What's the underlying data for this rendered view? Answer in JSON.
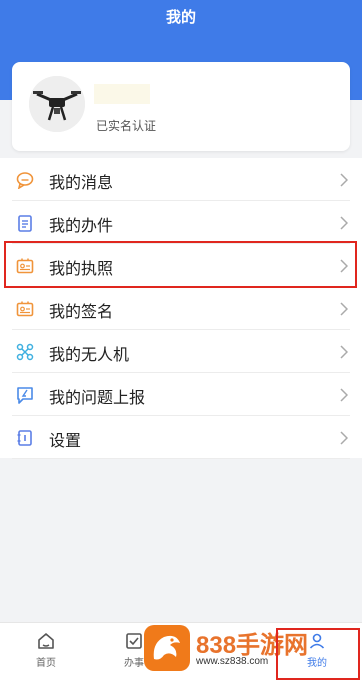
{
  "header": {
    "title": "我的"
  },
  "profile": {
    "verify_status": "已实名认证"
  },
  "menu": {
    "items": [
      {
        "label": "我的消息",
        "icon": "message-icon",
        "color": "#f0943a"
      },
      {
        "label": "我的办件",
        "icon": "document-icon",
        "color": "#5b7ee6"
      },
      {
        "label": "我的执照",
        "icon": "license-icon",
        "color": "#f0943a"
      },
      {
        "label": "我的签名",
        "icon": "signature-icon",
        "color": "#f0943a"
      },
      {
        "label": "我的无人机",
        "icon": "drone-icon",
        "color": "#3fb0e0"
      },
      {
        "label": "我的问题上报",
        "icon": "report-icon",
        "color": "#4a8ae8"
      },
      {
        "label": "设置",
        "icon": "settings-icon",
        "color": "#5b7ee6"
      }
    ]
  },
  "tabbar": {
    "home": "首页",
    "work": "办事",
    "mine": "我的"
  },
  "watermark": {
    "brand": "838手游网",
    "url": "www.sz838.com"
  },
  "colors": {
    "accent": "#3f7be8",
    "highlight": "#e0261e"
  }
}
